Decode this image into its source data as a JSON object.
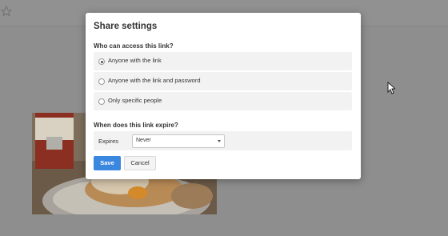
{
  "modal": {
    "title": "Share settings",
    "access_label": "Who can access this link?",
    "access_options": [
      {
        "label": "Anyone with the link",
        "checked": true
      },
      {
        "label": "Anyone with the link and password",
        "checked": false
      },
      {
        "label": "Only specific people",
        "checked": false
      }
    ],
    "expire_label": "When does this link expire?",
    "expires_field_label": "Expires",
    "expires_value": "Never",
    "save_label": "Save",
    "cancel_label": "Cancel"
  },
  "colors": {
    "accent": "#3a87e0",
    "overlay": "#8f8f8f"
  },
  "icons": {
    "star": "star-icon",
    "cursor": "mouse-cursor-icon"
  }
}
